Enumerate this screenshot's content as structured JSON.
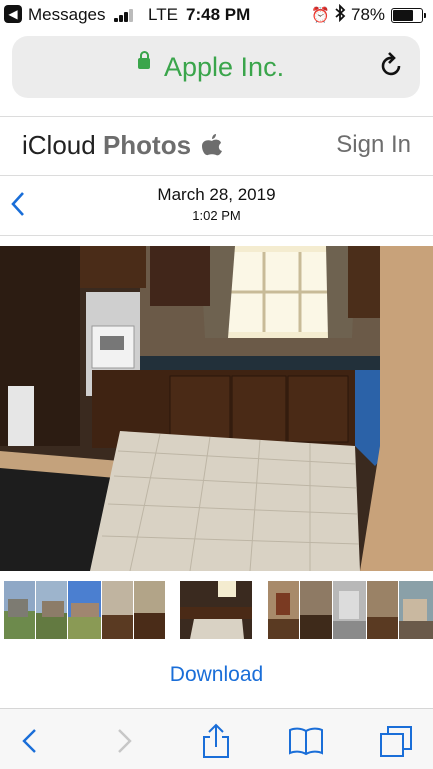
{
  "status": {
    "back_app": "Messages",
    "carrier": "LTE",
    "time": "7:48 PM",
    "battery_pct": "78%",
    "battery_level": 0.78
  },
  "address_bar": {
    "site": "Apple Inc."
  },
  "header": {
    "brand_part1": "iCloud",
    "brand_part2": "Photos",
    "sign_in": "Sign In"
  },
  "photo_info": {
    "date": "March 28, 2019",
    "time": "1:02 PM"
  },
  "actions": {
    "download": "Download"
  },
  "colors": {
    "accent_blue": "#1a6ed8",
    "secure_green": "#3aa54b"
  },
  "icons": [
    "back-app-icon",
    "lock-icon",
    "reload-icon",
    "apple-logo-icon",
    "back-chevron-icon",
    "share-icon",
    "bookmarks-icon",
    "tabs-icon",
    "forward-chevron-icon"
  ]
}
